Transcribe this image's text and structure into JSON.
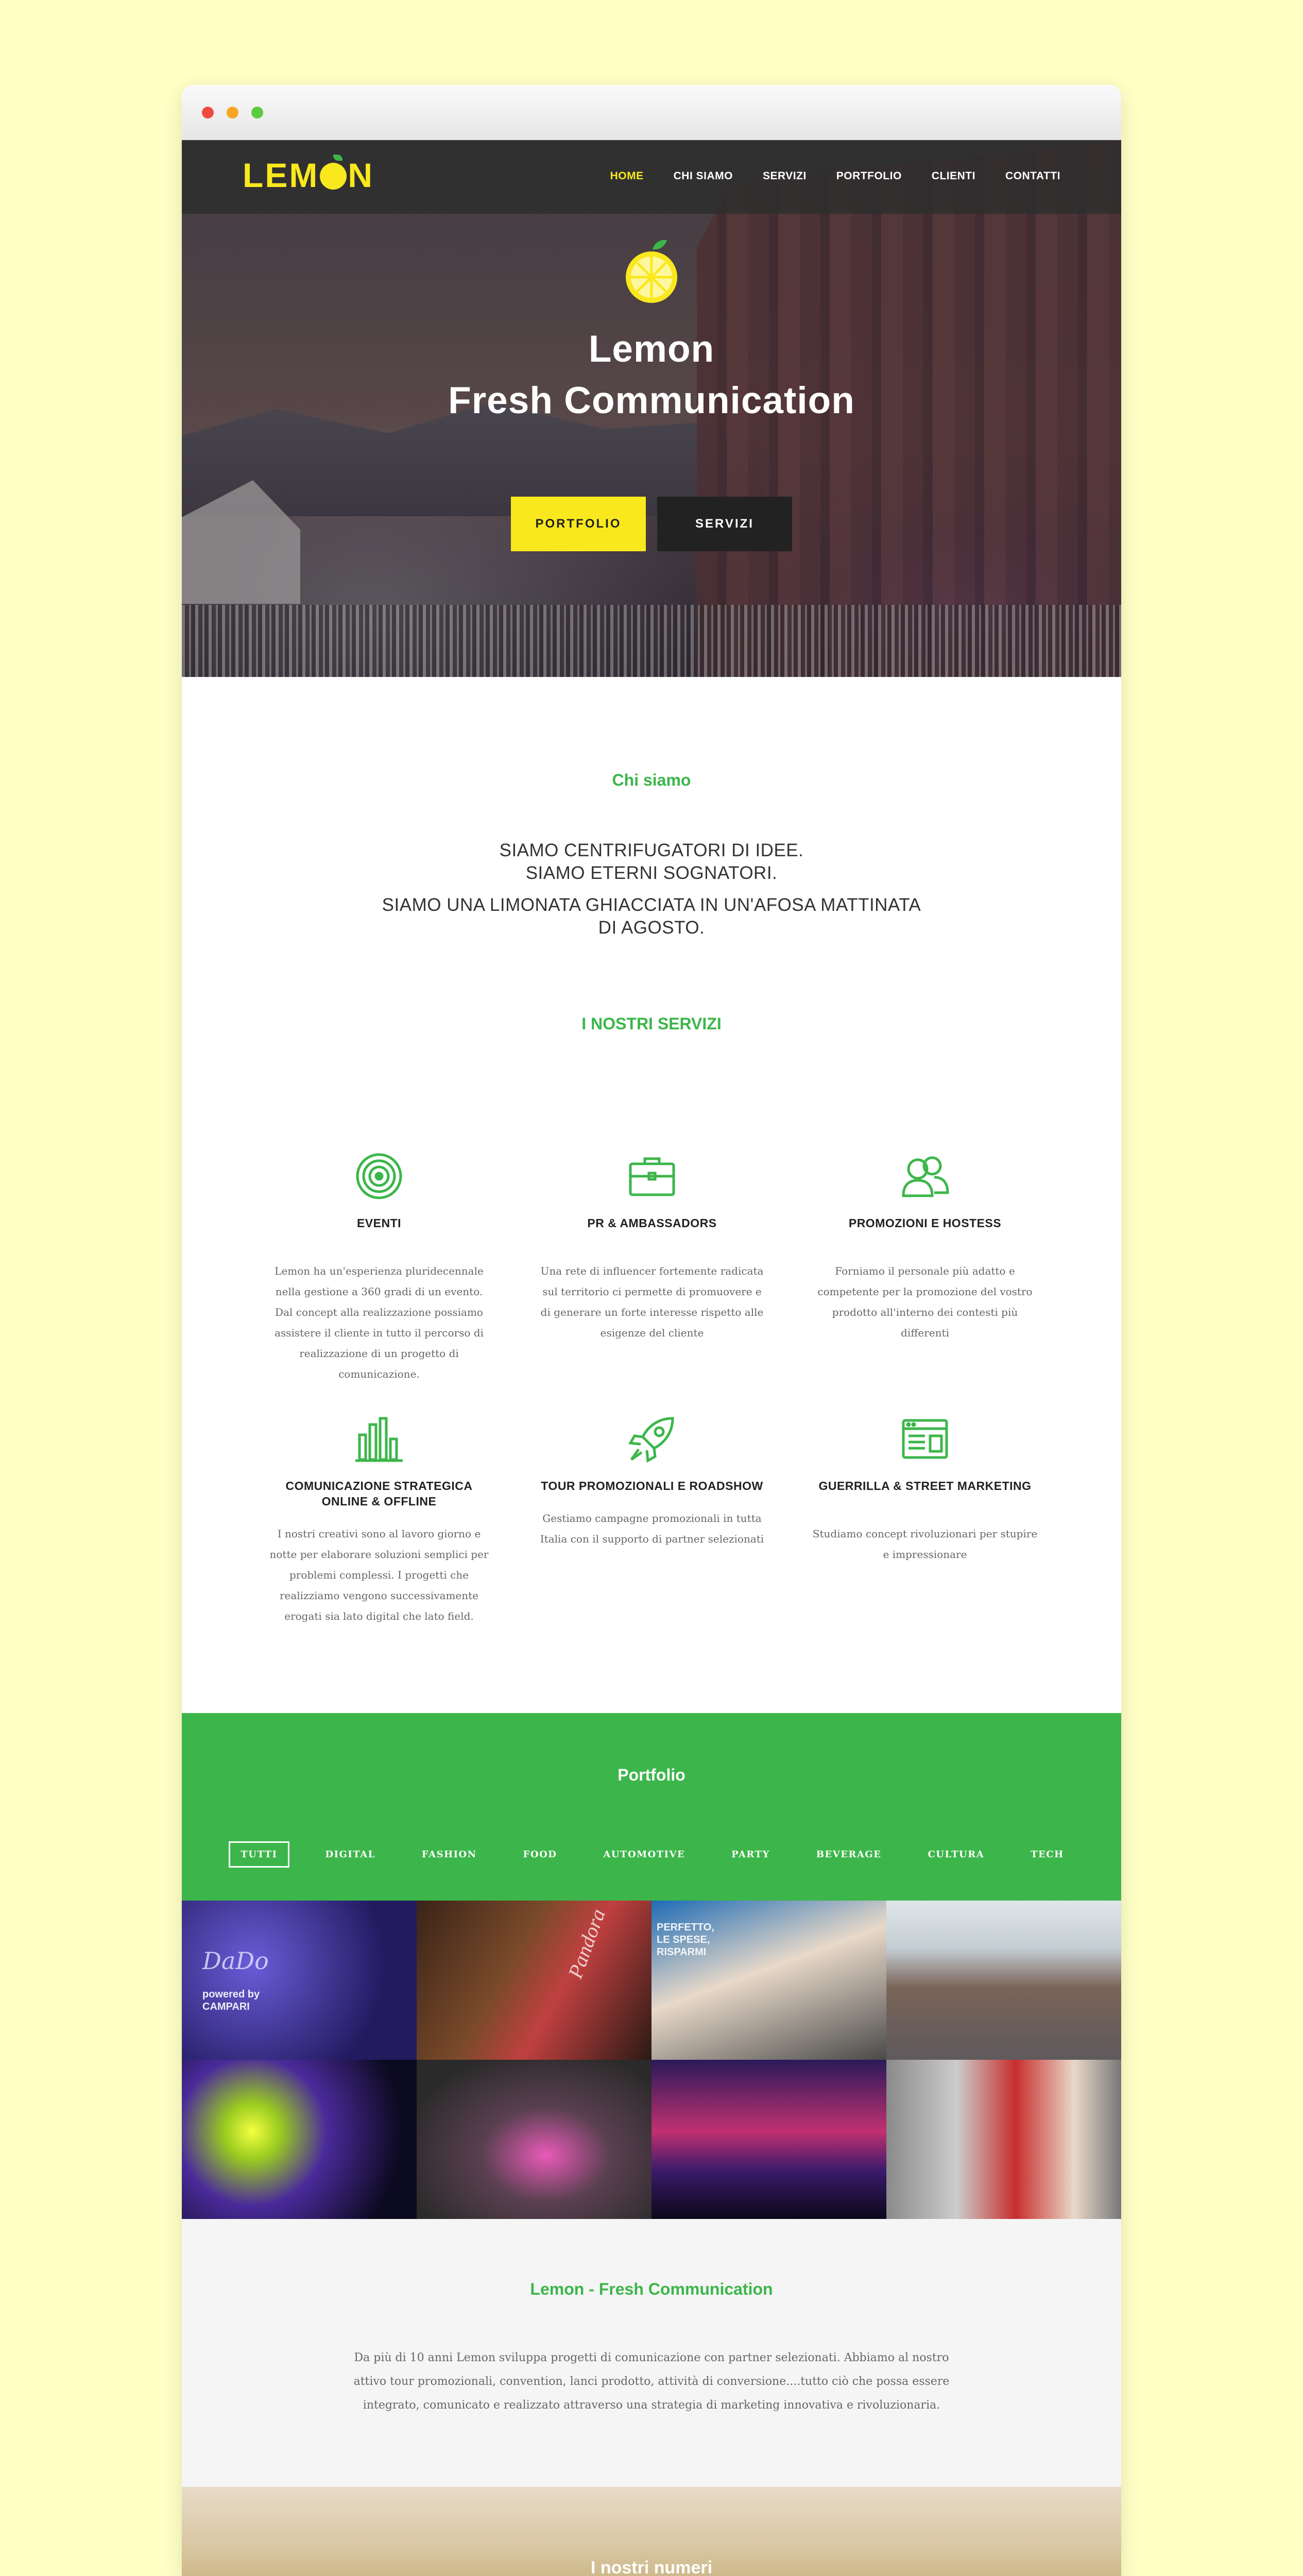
{
  "browser": {
    "controls": [
      "close",
      "minimize",
      "maximize"
    ]
  },
  "brand": {
    "logo_text_left": "LEM",
    "logo_text_right": "N",
    "accent": "#f9e81d",
    "green": "#3cb64a"
  },
  "nav": {
    "items": [
      "HOME",
      "CHI SIAMO",
      "SERVIZI",
      "PORTFOLIO",
      "CLIENTI",
      "CONTATTI"
    ],
    "active": "HOME"
  },
  "hero": {
    "title_line1": "Lemon",
    "title_line2": "Fresh Communication",
    "btn_portfolio": "PORTFOLIO",
    "btn_servizi": "SERVIZI"
  },
  "about": {
    "heading": "Chi siamo",
    "lines": [
      "SIAMO CENTRIFUGATORI DI IDEE.",
      "SIAMO ETERNI SOGNATORI.",
      "SIAMO UNA LIMONATA GHIACCIATA IN UN'AFOSA MATTINATA",
      "DI AGOSTO."
    ]
  },
  "services": {
    "heading": "I NOSTRI SERVIZI",
    "items": [
      {
        "icon": "vinyl-icon",
        "title": "EVENTI",
        "text": "Lemon ha un'esperienza pluridecennale nella gestione a 360 gradi di un evento. Dal concept alla realizzazione possiamo assistere il cliente in tutto il percorso di realizzazione di un progetto di comunicazione."
      },
      {
        "icon": "briefcase-icon",
        "title": "PR & AMBASSADORS",
        "text": "Una rete di influencer fortemente radicata sul territorio ci permette di promuovere e di generare un forte interesse rispetto alle esigenze del cliente"
      },
      {
        "icon": "users-icon",
        "title": "PROMOZIONI E HOSTESS",
        "text": "Forniamo il personale più adatto e competente per la promozione del vostro prodotto all'interno dei contesti più differenti"
      },
      {
        "icon": "bar-chart-icon",
        "title": "COMUNICAZIONE STRATEGICA ONLINE & OFFLINE",
        "text": "I nostri creativi sono al lavoro giorno e notte per elaborare soluzioni semplici per problemi complessi. I progetti che realizziamo vengono successivamente erogati sia lato digital che lato field."
      },
      {
        "icon": "rocket-icon",
        "title": "TOUR PROMOZIONALI E ROADSHOW",
        "text": "Gestiamo campagne promozionali in tutta Italia con il supporto di partner selezionati"
      },
      {
        "icon": "browser-window-icon",
        "title": "GUERRILLA & STREET MARKETING",
        "text": "Studiamo concept rivoluzionari per stupire e impressionare"
      }
    ]
  },
  "portfolio": {
    "heading": "Portfolio",
    "filters": [
      "TUTTI",
      "DIGITAL",
      "FASHION",
      "FOOD",
      "AUTOMOTIVE",
      "PARTY",
      "BEVERAGE",
      "CULTURA",
      "TECH"
    ],
    "active_filter": "TUTTI",
    "tile_texts": {
      "t1": "DaDo",
      "t1b": "powered by CAMPARI",
      "t2": "Pandora",
      "t3": "PERFETTO, LE SPESE, RISPARMI"
    }
  },
  "intro": {
    "heading": "Lemon - Fresh Communication",
    "text": "Da più di 10 anni Lemon sviluppa progetti di comunicazione con partner selezionati. Abbiamo al nostro attivo tour promozionali, convention, lanci prodotto, attività di conversione....tutto ciò che possa essere integrato, comunicato e realizzato attraverso una strategia di marketing innovativa e rivoluzionaria."
  },
  "numbers": {
    "heading": "I nostri numeri"
  }
}
